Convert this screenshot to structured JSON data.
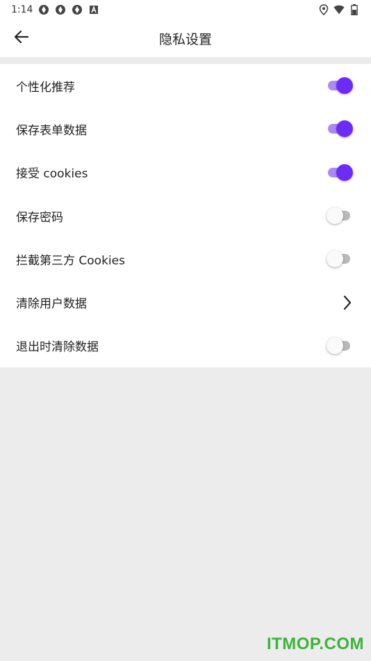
{
  "status_bar": {
    "time": "1:14",
    "icons": [
      "sync-icon",
      "sync-icon",
      "sync-icon",
      "a-badge-icon"
    ],
    "right_icons": [
      "location-icon",
      "wifi-icon",
      "battery-icon"
    ]
  },
  "header": {
    "back_icon": "arrow-left-icon",
    "title": "隐私设置"
  },
  "settings": [
    {
      "label": "个性化推荐",
      "control": "toggle",
      "checked": true
    },
    {
      "label": "保存表单数据",
      "control": "toggle",
      "checked": true
    },
    {
      "label": "接受 cookies",
      "control": "toggle",
      "checked": true
    },
    {
      "label": "保存密码",
      "control": "toggle",
      "checked": false
    },
    {
      "label": "拦截第三方 Cookies",
      "control": "toggle",
      "checked": false
    },
    {
      "label": "清除用户数据",
      "control": "chevron",
      "icon": "chevron-right-icon"
    },
    {
      "label": "退出时清除数据",
      "control": "toggle",
      "checked": false
    }
  ],
  "colors": {
    "accent": "#6c2cf5",
    "accent_track": "#a98bf3",
    "off_track": "#b9b9b9",
    "background": "#ececec",
    "watermark": "#3cb33c"
  },
  "watermark": "ITMOP.COM"
}
